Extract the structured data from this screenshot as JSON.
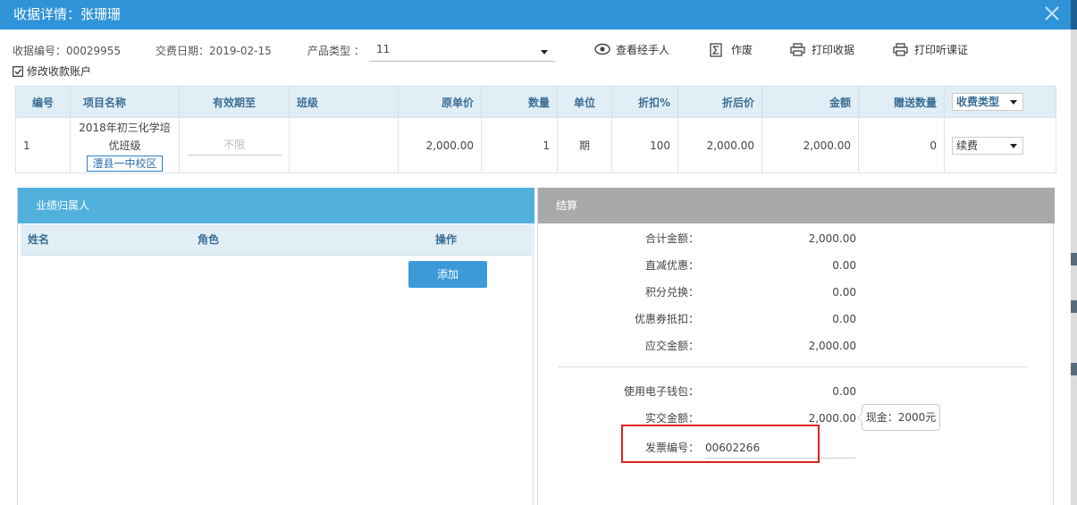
{
  "dialog": {
    "title": "收据详情：张珊珊",
    "colors": {
      "titlebar": "#2f93d8",
      "left_panel": "#51b0dc",
      "right_panel": "#a9a9a9",
      "highlight": "#e02020"
    }
  },
  "info": {
    "receipt_no": "收据编号：00029955",
    "pay_date": "交费日期：2019-02-15",
    "product_type_label": "产品类型 ：",
    "product_type_value": "11",
    "edit_account": "修改收款账户"
  },
  "toolbar": {
    "view_handler": "查看经手人",
    "void": "作废",
    "print_receipt": "打印收据",
    "print_attend": "打印听课证"
  },
  "table": {
    "headers": {
      "no": "编号",
      "project": "项目名称",
      "valid": "有效期至",
      "class": "班级",
      "orig_price": "原单价",
      "qty": "数量",
      "unit": "单位",
      "discount": "折扣%",
      "disc_price": "折后价",
      "amount": "金额",
      "gift_qty": "赠送数量",
      "fee_type": "收费类型"
    },
    "rows": [
      {
        "no": "1",
        "project_line1": "2018年初三化学培",
        "project_line2": "优班级",
        "campus": "澧县一中校区",
        "valid": "不限",
        "class": "",
        "orig_price": "2,000.00",
        "qty": "1",
        "unit": "期",
        "discount": "100",
        "disc_price": "2,000.00",
        "amount": "2,000.00",
        "gift_qty": "0",
        "fee_type": "续费"
      }
    ]
  },
  "performance": {
    "title": "业绩归属人",
    "col_name": "姓名",
    "col_role": "角色",
    "col_action": "操作",
    "add_label": "添加"
  },
  "settlement": {
    "title": "结算",
    "total_label": "合计金额：",
    "total": "2,000.00",
    "direct_label": "直减优惠：",
    "direct": "0.00",
    "points_label": "积分兑换：",
    "points": "0.00",
    "coupon_label": "优惠券抵扣：",
    "coupon": "0.00",
    "due_label": "应交金额：",
    "due": "2,000.00",
    "wallet_label": "使用电子钱包：",
    "wallet": "0.00",
    "paid_label": "实交金额：",
    "paid": "2,000.00",
    "cash_tip": "现金：2000元",
    "invoice_label": "发票编号：",
    "invoice": "00602266"
  }
}
